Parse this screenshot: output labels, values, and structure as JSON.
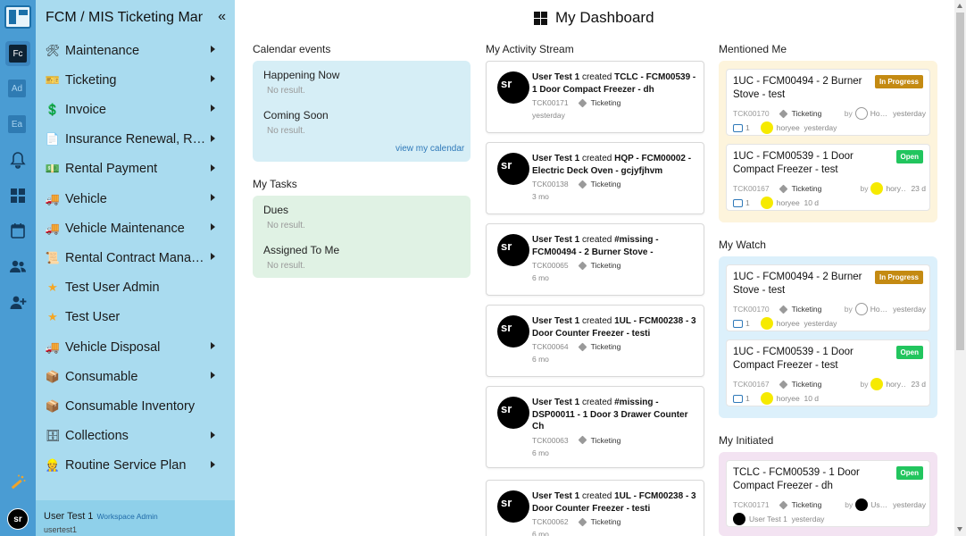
{
  "app": {
    "title": "FCM / MIS Ticketing Manag",
    "collapse_icon": "«"
  },
  "workspaces": [
    "Fc",
    "Ad",
    "Ea"
  ],
  "menu": [
    {
      "label": "Maintenance",
      "icon": "tools-icon",
      "arrow": true
    },
    {
      "label": "Ticketing",
      "icon": "ticket-icon",
      "arrow": true
    },
    {
      "label": "Invoice",
      "icon": "invoice-icon",
      "arrow": true
    },
    {
      "label": "Insurance Renewal, Road…",
      "icon": "document-icon",
      "arrow": true
    },
    {
      "label": "Rental Payment",
      "icon": "money-icon",
      "arrow": true
    },
    {
      "label": "Vehicle",
      "icon": "truck-icon",
      "arrow": true
    },
    {
      "label": "Vehicle Maintenance",
      "icon": "truck-icon",
      "arrow": true
    },
    {
      "label": "Rental Contract Manage…",
      "icon": "contract-icon",
      "arrow": true
    },
    {
      "label": "Test User Admin",
      "icon": "star-icon",
      "arrow": false
    },
    {
      "label": "Test User",
      "icon": "star-icon",
      "arrow": false
    },
    {
      "label": "Vehicle Disposal",
      "icon": "truck-icon",
      "arrow": true
    },
    {
      "label": "Consumable",
      "icon": "package-icon",
      "arrow": true
    },
    {
      "label": "Consumable Inventory",
      "icon": "package-icon",
      "arrow": false
    },
    {
      "label": "Collections",
      "icon": "archive-icon",
      "arrow": true
    },
    {
      "label": "Routine Service Plan",
      "icon": "worker-icon",
      "arrow": true
    }
  ],
  "user": {
    "name": "User Test 1",
    "role": "Workspace Admin",
    "login": "usertest1",
    "initials": "sr"
  },
  "dashboard": {
    "title": "My Dashboard",
    "calendar": {
      "title": "Calendar events",
      "now_label": "Happening Now",
      "now_empty": "No result.",
      "soon_label": "Coming Soon",
      "soon_empty": "No result.",
      "link": "view my calendar"
    },
    "tasks": {
      "title": "My Tasks",
      "dues_label": "Dues",
      "dues_empty": "No result.",
      "assigned_label": "Assigned To Me",
      "assigned_empty": "No result."
    },
    "activity": {
      "title": "My Activity Stream",
      "items": [
        {
          "user": "User Test 1",
          "verb": "created",
          "subject": "TCLC - FCM00539 - 1 Door Compact Freezer - dh",
          "ticket": "TCK00171",
          "module": "Ticketing",
          "time": "yesterday"
        },
        {
          "user": "User Test 1",
          "verb": "created",
          "subject": "HQP - FCM00002 - Electric Deck Oven - gcjyfjhvm",
          "ticket": "TCK00138",
          "module": "Ticketing",
          "time": "3 mo"
        },
        {
          "user": "User Test 1",
          "verb": "created",
          "subject": "#missing - FCM00494 - 2 Burner Stove -",
          "ticket": "TCK00065",
          "module": "Ticketing",
          "time": "6 mo"
        },
        {
          "user": "User Test 1",
          "verb": "created",
          "subject": "1UL - FCM00238 - 3 Door Counter Freezer - testi",
          "ticket": "TCK00064",
          "module": "Ticketing",
          "time": "6 mo"
        },
        {
          "user": "User Test 1",
          "verb": "created",
          "subject": "#missing - DSP00011 - 1 Door 3 Drawer Counter Ch",
          "ticket": "TCK00063",
          "module": "Ticketing",
          "time": "6 mo"
        },
        {
          "user": "User Test 1",
          "verb": "created",
          "subject": "1UL - FCM00238 - 3 Door Counter Freezer - testi",
          "ticket": "TCK00062",
          "module": "Ticketing",
          "time": "6 mo"
        }
      ]
    },
    "mentioned": {
      "title": "Mentioned Me",
      "items": [
        {
          "title": "1UC - FCM00494 - 2 Burner Stove - test",
          "status": "In Progress",
          "ticket": "TCK00170",
          "module": "Ticketing",
          "by_label": "by",
          "by_name": "Ho…",
          "when": "yesterday",
          "comments": "1",
          "last_user": "horyee",
          "last_time": "yesterday"
        },
        {
          "title": "1UC - FCM00539 - 1 Door Compact Freezer - test",
          "status": "Open",
          "ticket": "TCK00167",
          "module": "Ticketing",
          "by_label": "by",
          "by_name": "hory…",
          "when": "23 d",
          "comments": "1",
          "last_user": "horyee",
          "last_time": "10 d"
        }
      ]
    },
    "watch": {
      "title": "My Watch",
      "items": [
        {
          "title": "1UC - FCM00494 - 2 Burner Stove - test",
          "status": "In Progress",
          "ticket": "TCK00170",
          "module": "Ticketing",
          "by_label": "by",
          "by_name": "Ho…",
          "when": "yesterday",
          "comments": "1",
          "last_user": "horyee",
          "last_time": "yesterday"
        },
        {
          "title": "1UC - FCM00539 - 1 Door Compact Freezer - test",
          "status": "Open",
          "ticket": "TCK00167",
          "module": "Ticketing",
          "by_label": "by",
          "by_name": "hory…",
          "when": "23 d",
          "comments": "1",
          "last_user": "horyee",
          "last_time": "10 d"
        }
      ]
    },
    "initiated": {
      "title": "My Initiated",
      "items": [
        {
          "title": "TCLC - FCM00539 - 1 Door Compact Freezer - dh",
          "status": "Open",
          "ticket": "TCK00171",
          "module": "Ticketing",
          "by_label": "by",
          "by_name": "Us…",
          "when": "yesterday",
          "last_user": "User Test 1",
          "last_time": "yesterday"
        }
      ]
    }
  },
  "colors": {
    "rail": "#4a9cd3",
    "menu": "#a9dbef",
    "calendar_bg": "#d6eef6",
    "tasks_bg": "#e0f2e4",
    "mentioned_bg": "#fdf4dc",
    "watch_bg": "#dcf0fb",
    "initiated_bg": "#f3e3f2",
    "in_progress": "#c48a12",
    "open": "#22c55e"
  }
}
